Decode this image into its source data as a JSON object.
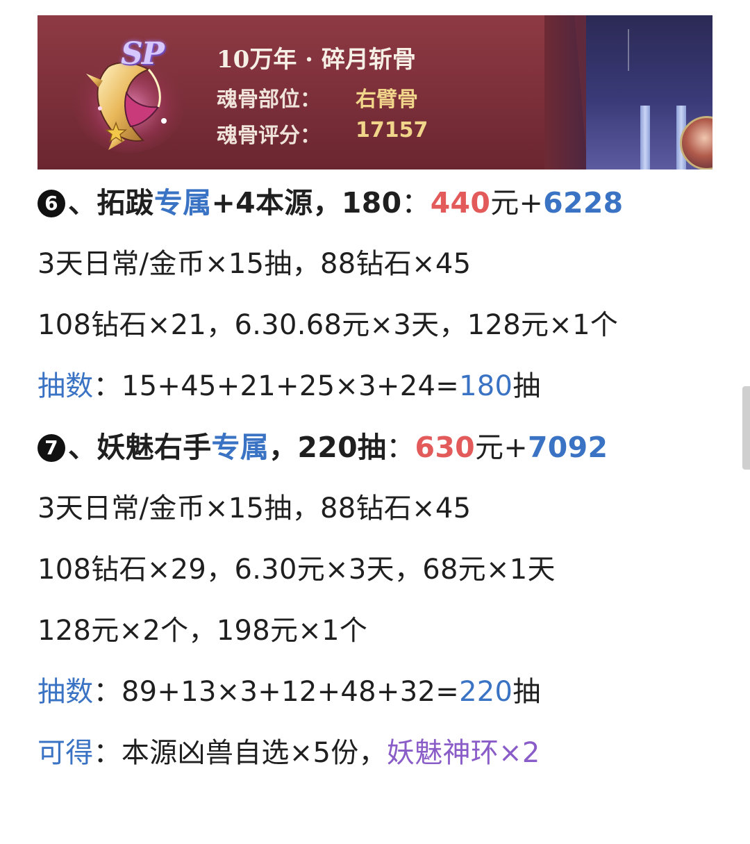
{
  "banner": {
    "badge": "SP",
    "title": "10万年 · 碎月斩骨",
    "part_label": "魂骨部位：",
    "part_value": "右臂骨",
    "score_label": "魂骨评分：",
    "score_value": "17157"
  },
  "sections": [
    {
      "number": "6",
      "heading": {
        "sep": "、",
        "a": "拓跋",
        "b": "专属",
        "c": "+4本源，180",
        "colon": "：",
        "price": "440",
        "unit": "元+",
        "diamonds": "6228"
      },
      "lines": [
        "3天日常/金币×15抽，88钻石×45",
        "108钻石×21，6.30.68元×3天，128元×1个"
      ],
      "draws": {
        "label": "抽数",
        "colon": "：",
        "formula": "15+45+21+25×3+24=",
        "total": "180",
        "suffix": "抽"
      }
    },
    {
      "number": "7",
      "heading": {
        "sep": "、",
        "a": "妖魅右手",
        "b": "专属",
        "c": "，220抽",
        "colon": "：",
        "price": "630",
        "unit": "元+",
        "diamonds": "7092"
      },
      "lines": [
        "3天日常/金币×15抽，88钻石×45",
        "108钻石×29，6.30元×3天，68元×1天",
        "128元×2个，198元×1个"
      ],
      "draws": {
        "label": "抽数",
        "colon": "：",
        "formula": "89+13×3+12+48+32=",
        "total": "220",
        "suffix": "抽"
      },
      "rewards": {
        "label": "可得",
        "colon": "：",
        "text": "本源凶兽自选×5份，",
        "highlight": "妖魅神环×2"
      }
    }
  ],
  "colors": {
    "link_blue": "#3a73c4",
    "price_red": "#e35a5a",
    "reward_purple": "#8a5cc8",
    "banner_red": "#7b2f39"
  },
  "icons": [
    "soul-bone-emblem-icon",
    "star-icon",
    "character-avatar"
  ]
}
